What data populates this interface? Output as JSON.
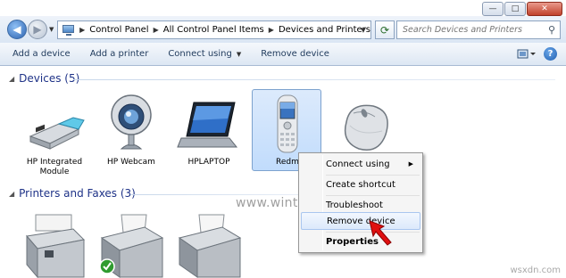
{
  "window": {
    "minimize_glyph": "—",
    "maximize_glyph": "□",
    "close_glyph": "✕"
  },
  "nav": {
    "back_glyph": "◀",
    "forward_glyph": "▶",
    "dropdown_glyph": "▼"
  },
  "address": {
    "separator": "▶",
    "crumbs": [
      "Control Panel",
      "All Control Panel Items",
      "Devices and Printers"
    ],
    "dropdown_glyph": "▼",
    "refresh_glyph": "⟳"
  },
  "search": {
    "placeholder": "Search Devices and Printers",
    "icon": "search-icon"
  },
  "toolbar": {
    "items": [
      {
        "label": "Add a device",
        "has_caret": false
      },
      {
        "label": "Add a printer",
        "has_caret": false
      },
      {
        "label": "Connect using",
        "has_caret": true
      },
      {
        "label": "Remove device",
        "has_caret": false
      }
    ],
    "caret_glyph": "▼",
    "help_glyph": "?"
  },
  "groups": {
    "devices": {
      "title": "Devices (5)",
      "items": [
        {
          "label_1": "HP Integrated",
          "label_2": "Module",
          "icon": "usb-module-icon"
        },
        {
          "label_1": "HP Webcam",
          "label_2": "",
          "icon": "webcam-icon"
        },
        {
          "label_1": "HPLAPTOP",
          "label_2": "",
          "icon": "laptop-icon"
        },
        {
          "label_1": "Redmi",
          "label_2": "",
          "icon": "phone-icon",
          "selected": true
        },
        {
          "label_1": "",
          "label_2": "",
          "icon": "mouse-icon"
        }
      ]
    },
    "printers": {
      "title": "Printers and Faxes (3)",
      "items": [
        {
          "icon": "fax-icon"
        },
        {
          "icon": "printer-default-icon"
        },
        {
          "icon": "printer-icon"
        }
      ]
    },
    "collapse_glyph": "◢"
  },
  "context_menu": {
    "items": {
      "connect_using": "Connect using",
      "create_shortcut": "Create shortcut",
      "troubleshoot": "Troubleshoot",
      "remove_device": "Remove device",
      "properties": "Properties"
    },
    "submenu_glyph": "▶",
    "highlighted": "Remove device"
  },
  "watermark": "www.wintips.org",
  "site_mark": "wsxdn.com",
  "colors": {
    "group_header": "#1e3287",
    "selection": "#c1dcfc",
    "pointer_arrow": "#e01010"
  }
}
